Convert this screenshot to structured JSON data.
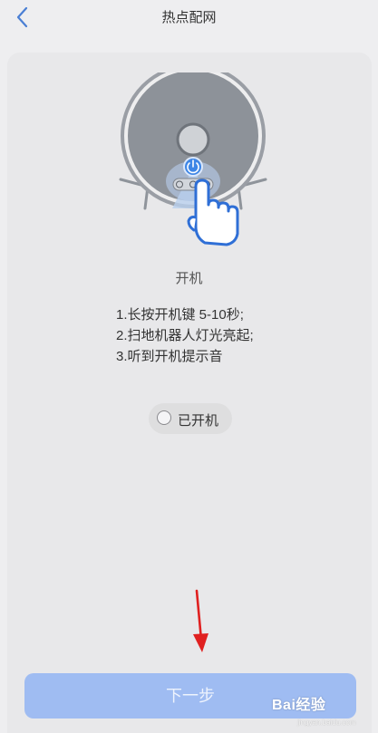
{
  "header": {
    "title": "热点配网",
    "back_icon": "chevron-left-icon"
  },
  "step": {
    "title": "开机",
    "instructions": [
      "1.长按开机键 5-10秒;",
      "2.扫地机器人灯光亮起;",
      "3.听到开机提示音"
    ],
    "confirm_label": "已开机",
    "confirm_checked": false
  },
  "footer": {
    "next_label": "下一步"
  },
  "watermark": {
    "brand": "Bai经验",
    "url": "jingyan.baidu.com"
  },
  "colors": {
    "accent": "#4a90e2",
    "next_button_bg": "#9fbcf2",
    "annotation_arrow": "#e02020",
    "background": "#eeeef0"
  }
}
